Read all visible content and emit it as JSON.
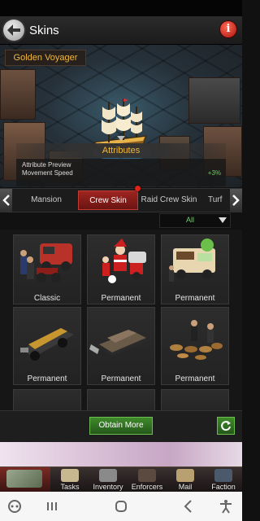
{
  "header": {
    "title": "Skins"
  },
  "preview": {
    "skin_name": "Golden Voyager",
    "attributes_title": "Attributes",
    "attribute_preview_label": "Attribute Preview",
    "attribute_name": "Movement Speed",
    "attribute_value": "+3%"
  },
  "tabs": [
    {
      "label": "Mansion",
      "active": false
    },
    {
      "label": "Crew Skin",
      "active": true
    },
    {
      "label": "Raid Crew Skin",
      "active": false
    },
    {
      "label": "Turf",
      "active": false
    }
  ],
  "filter": {
    "selected": "All"
  },
  "skins": [
    {
      "label": "Classic",
      "icon": "crew-van-icon"
    },
    {
      "label": "Permanent",
      "icon": "santa-crew-icon"
    },
    {
      "label": "Permanent",
      "icon": "food-truck-icon"
    },
    {
      "label": "Permanent",
      "icon": "armored-truck-icon"
    },
    {
      "label": "Permanent",
      "icon": "tank-icon"
    },
    {
      "label": "Permanent",
      "icon": "dog-pack-icon"
    }
  ],
  "actions": {
    "obtain_more": "Obtain More"
  },
  "bottom_nav": [
    {
      "label": "",
      "icon": "city-map-icon"
    },
    {
      "label": "Tasks",
      "icon": "tasks-icon"
    },
    {
      "label": "Inventory",
      "icon": "inventory-icon"
    },
    {
      "label": "Enforcers",
      "icon": "enforcers-icon"
    },
    {
      "label": "Mail",
      "icon": "mail-icon"
    },
    {
      "label": "Faction",
      "icon": "faction-icon"
    }
  ],
  "colors": {
    "accent_gold": "#f0b840",
    "active_tab": "#9e2420",
    "positive": "#5fd35a",
    "button_green": "#3f8a2a"
  }
}
